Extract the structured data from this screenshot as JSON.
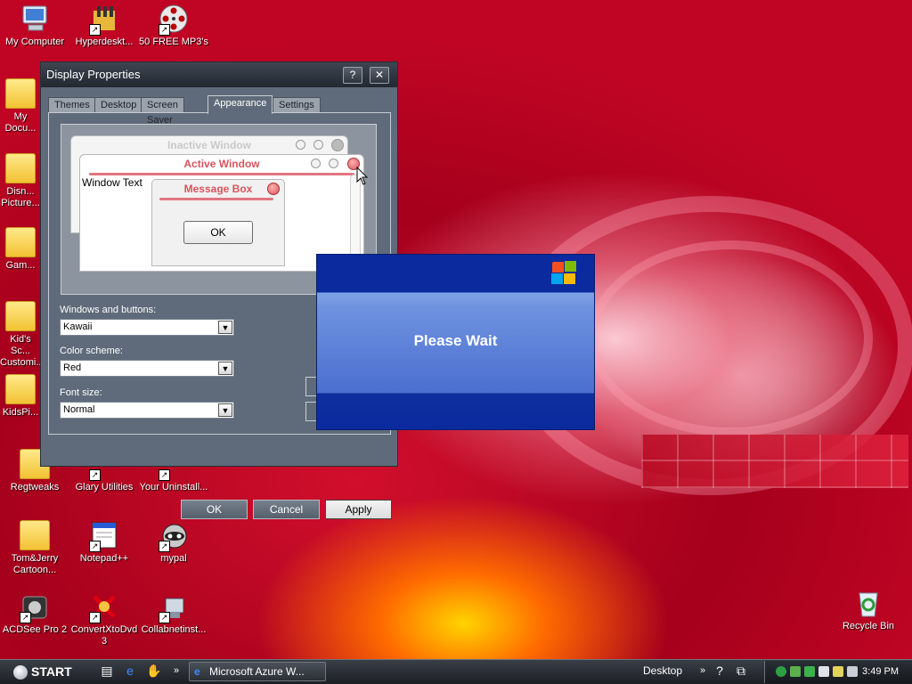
{
  "desktop": {
    "icons": [
      {
        "label": "My Computer"
      },
      {
        "label": "Hyperdeskt..."
      },
      {
        "label": "50 FREE MP3's"
      },
      {
        "label": "My Docu..."
      },
      {
        "label": "Disn... Picture..."
      },
      {
        "label": "Gam..."
      },
      {
        "label": "Kid's Sc... Customi..."
      },
      {
        "label": "KidsPi..."
      },
      {
        "label": "Regtweaks"
      },
      {
        "label": "Glary Utilities"
      },
      {
        "label": "Your Uninstall..."
      },
      {
        "label": "Tom&Jerry Cartoon..."
      },
      {
        "label": "Notepad++"
      },
      {
        "label": "mypal"
      },
      {
        "label": "ACDSee Pro 2"
      },
      {
        "label": "ConvertXtoDvd 3"
      },
      {
        "label": "Collabnetinst..."
      },
      {
        "label": "Recycle Bin"
      }
    ]
  },
  "display_properties": {
    "title": "Display Properties",
    "help_glyph": "?",
    "close_glyph": "✕",
    "tabs": [
      {
        "label": "Themes"
      },
      {
        "label": "Desktop"
      },
      {
        "label": "Screen Saver"
      },
      {
        "label": "Appearance"
      },
      {
        "label": "Settings"
      }
    ],
    "active_tab": "Appearance",
    "preview": {
      "inactive_window": "Inactive Window",
      "active_window": "Active Window",
      "window_text": "Window Text",
      "message_box": "Message Box",
      "ok": "OK"
    },
    "fields": {
      "windows_buttons_label": "Windows and buttons:",
      "windows_buttons_value": "Kawaii",
      "color_scheme_label": "Color scheme:",
      "color_scheme_value": "Red",
      "font_size_label": "Font size:",
      "font_size_value": "Normal"
    },
    "buttons": {
      "ok": "OK",
      "cancel": "Cancel",
      "apply": "Apply"
    }
  },
  "please_wait": {
    "text": "Please Wait"
  },
  "taskbar": {
    "start_label": "START",
    "task_label": "Microsoft Azure W...",
    "desktop_toolbar_label": "Desktop",
    "chevron": "»",
    "clock": "3:49 PM"
  },
  "colors": {
    "dialog_bg": "#5f6b7a",
    "preview_accent": "#d8545e",
    "please_wait_blue": "#0a2a9e"
  }
}
